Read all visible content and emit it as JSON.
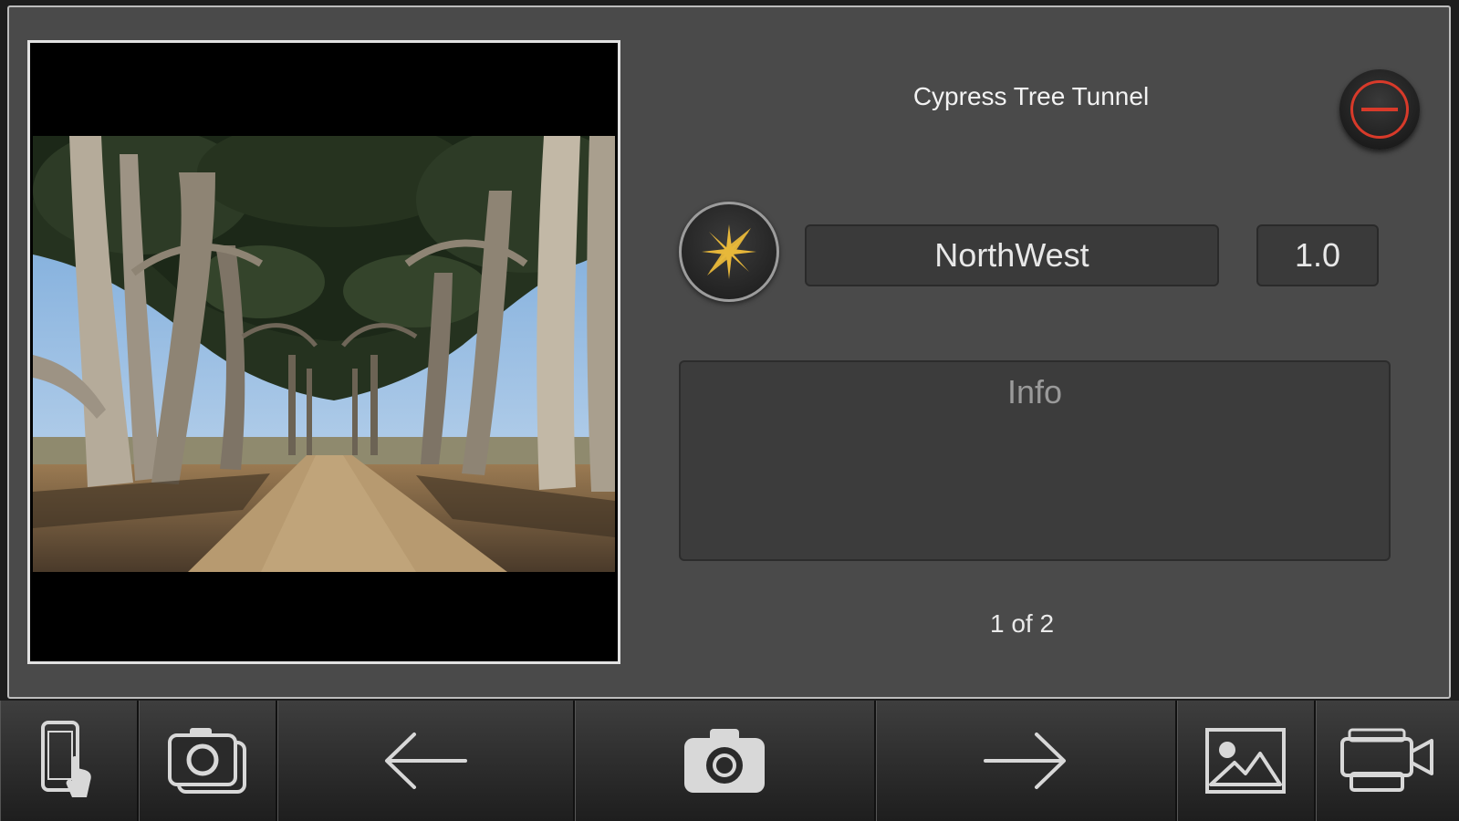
{
  "location": {
    "title": "Cypress Tree Tunnel",
    "direction": "NorthWest",
    "zoom": "1.0",
    "info_placeholder": "Info",
    "page_indicator": "1 of 2"
  },
  "photo": {
    "subject": "tree tunnel road photograph"
  },
  "toolbar": {
    "items": [
      {
        "name": "device-touch-icon"
      },
      {
        "name": "photo-stack-icon"
      },
      {
        "name": "arrow-left-icon"
      },
      {
        "name": "camera-icon"
      },
      {
        "name": "arrow-right-icon"
      },
      {
        "name": "image-icon"
      },
      {
        "name": "video-camera-icon"
      }
    ]
  },
  "colors": {
    "panel_bg": "#4a4a4a",
    "delete_accent": "#d83a2a",
    "compass_accent": "#e7b73a",
    "icon_color": "#d8d8d8"
  }
}
